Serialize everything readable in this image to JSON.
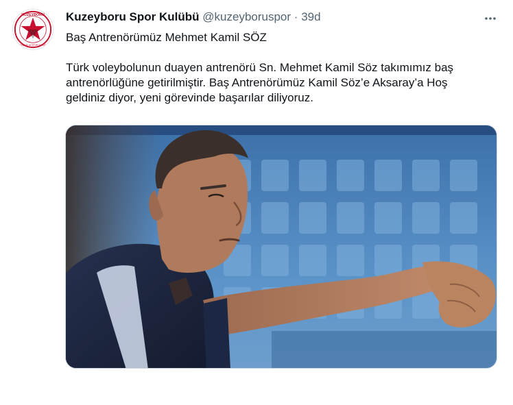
{
  "tweet": {
    "display_name": "Kuzeyboru Spor Kulübü",
    "handle": "@kuzeyboruspor",
    "separator": "·",
    "time": "39d",
    "more_icon": "ellipsis-horizontal-icon",
    "avatar": {
      "logo_text_top": "KUZEYBORU",
      "logo_text_bottom": "GENÇLİK ve SPOR KULÜBÜ",
      "colors": {
        "ring": "#c8102e",
        "star": "#c8102e",
        "accent": "#1a1a1a"
      }
    },
    "text_lines": [
      "Baş Antrenörümüz Mehmet Kamil SÖZ",
      "",
      "Türk voleybolunun duayen antrenörü Sn. Mehmet Kamil Söz takımımız baş",
      "antrenörlüğüne getirilmiştir. Baş Antrenörümüz Kamil Söz’e Aksaray’a Hoş",
      "geldiniz diyor, yeni görevinde başarılar diliyoruz."
    ],
    "photo": {
      "subject": "coach-pointing-photo",
      "colors": {
        "seats": "#4a86c4",
        "jacket": "#1c2744",
        "stripe": "#c9d3e6",
        "skin": "#b07a5c",
        "hair": "#3a2f2a"
      }
    }
  },
  "colors": {
    "text_primary": "#0f1419",
    "text_secondary": "#536471",
    "border": "#cfd9de"
  }
}
